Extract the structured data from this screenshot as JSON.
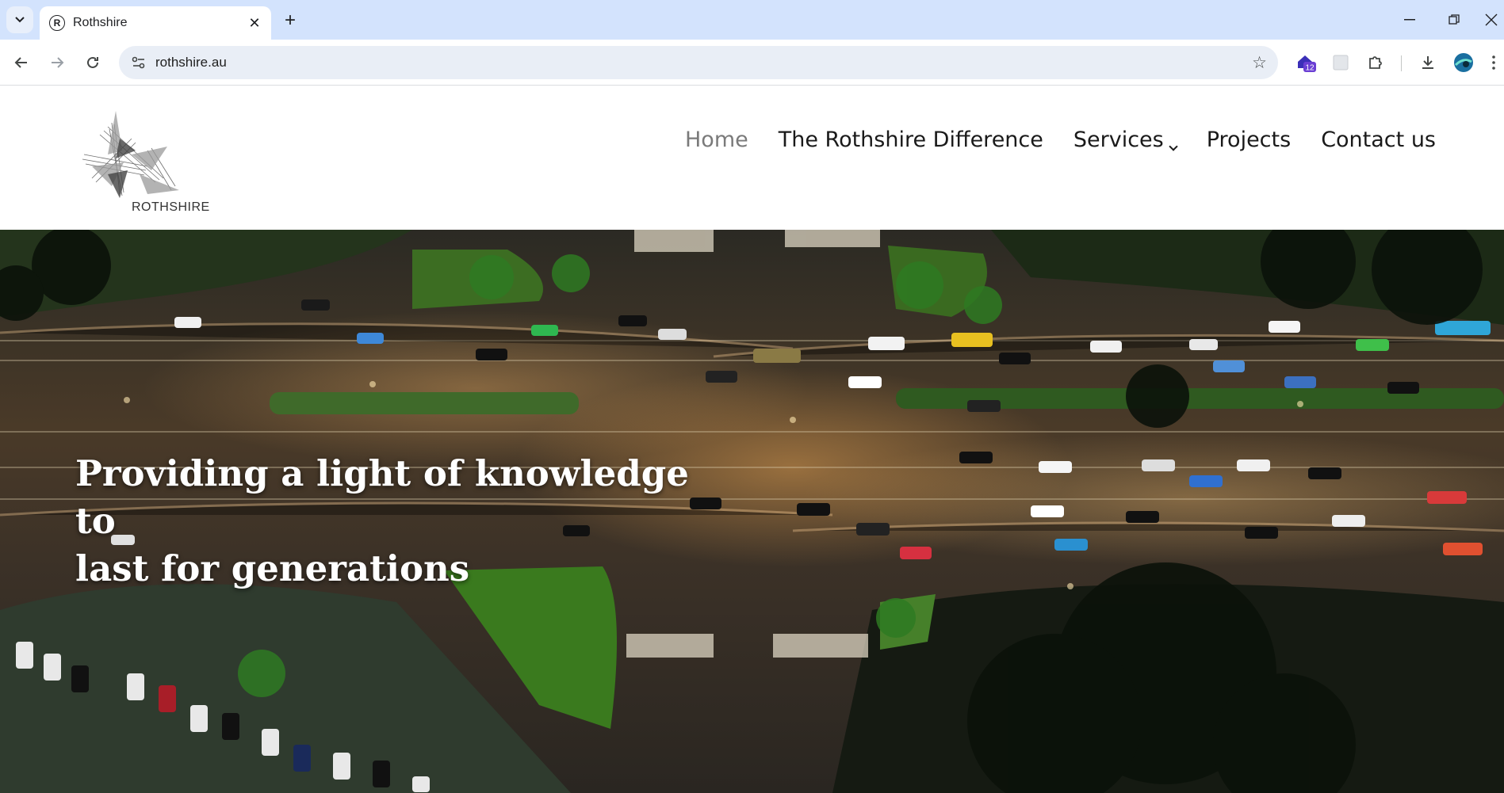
{
  "browser": {
    "tab": {
      "title": "Rothshire",
      "favicon": "R"
    },
    "url": "rothshire.au",
    "extension_badge": "12"
  },
  "site": {
    "logo_text": "ROTHSHIRE",
    "nav": [
      {
        "label": "Home",
        "active": true
      },
      {
        "label": "The Rothshire Difference"
      },
      {
        "label": "Services",
        "has_dropdown": true
      },
      {
        "label": "Projects"
      },
      {
        "label": "Contact us"
      }
    ]
  },
  "hero": {
    "headline_line1": "Providing a light of knowledge to",
    "headline_line2": "last for generations"
  },
  "colors": {
    "tabstrip": "#d3e3fd",
    "omnibox": "#e9eef6",
    "nav_active": "#7a7a7a",
    "nav_text": "#1a1a1a"
  }
}
